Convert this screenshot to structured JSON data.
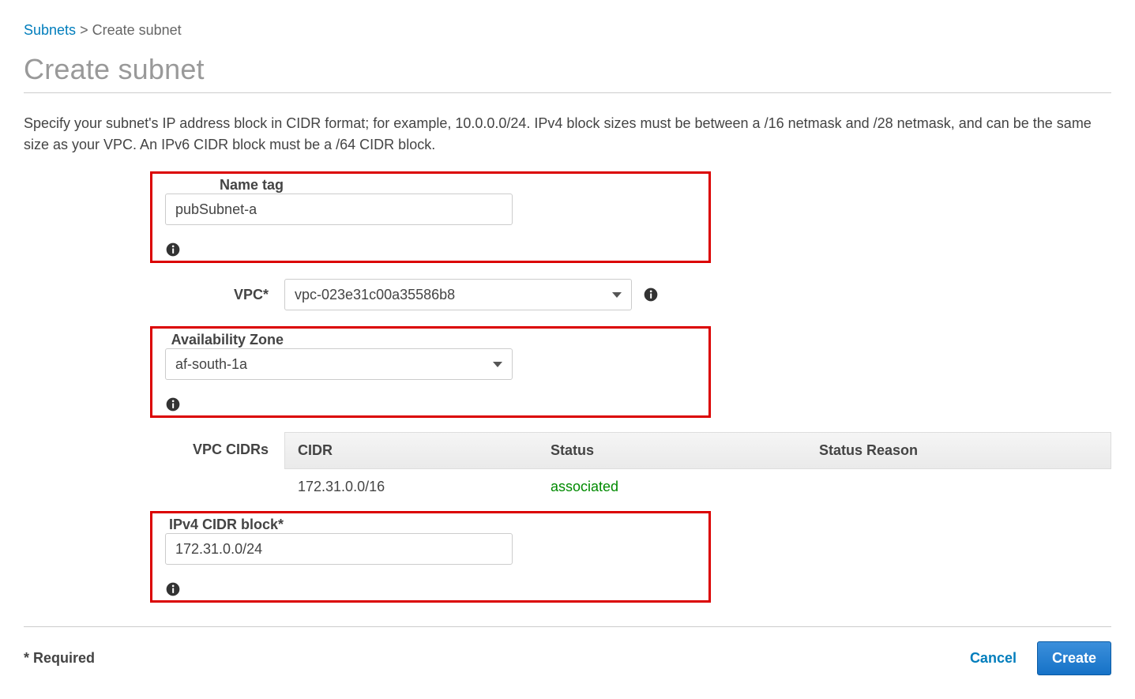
{
  "breadcrumb": {
    "root_label": "Subnets",
    "separator": ">",
    "current": "Create subnet"
  },
  "page": {
    "title": "Create subnet",
    "intro": "Specify your subnet's IP address block in CIDR format; for example, 10.0.0.0/24. IPv4 block sizes must be between a /16 netmask and /28 netmask, and can be the same size as your VPC. An IPv6 CIDR block must be a /64 CIDR block."
  },
  "form": {
    "name_tag": {
      "label": "Name tag",
      "value": "pubSubnet-a"
    },
    "vpc": {
      "label": "VPC*",
      "value": "vpc-023e31c00a35586b8"
    },
    "az": {
      "label": "Availability Zone",
      "value": "af-south-1a"
    },
    "vpc_cidrs": {
      "label": "VPC CIDRs",
      "columns": {
        "cidr": "CIDR",
        "status": "Status",
        "reason": "Status Reason"
      },
      "rows": [
        {
          "cidr": "172.31.0.0/16",
          "status": "associated",
          "reason": ""
        }
      ]
    },
    "ipv4_block": {
      "label": "IPv4 CIDR block*",
      "value": "172.31.0.0/24"
    }
  },
  "footer": {
    "required_note": "* Required",
    "cancel_label": "Cancel",
    "create_label": "Create"
  }
}
